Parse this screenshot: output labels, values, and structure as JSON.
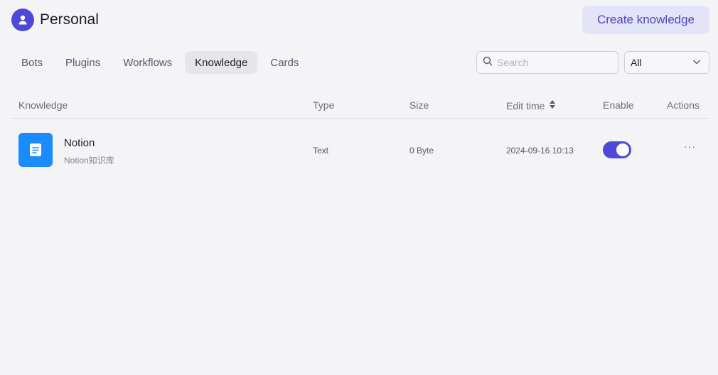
{
  "header": {
    "title": "Personal",
    "avatar_icon": "user-icon",
    "create_button": "Create knowledge"
  },
  "tabs": [
    {
      "label": "Bots",
      "active": false
    },
    {
      "label": "Plugins",
      "active": false
    },
    {
      "label": "Workflows",
      "active": false
    },
    {
      "label": "Knowledge",
      "active": true
    },
    {
      "label": "Cards",
      "active": false
    }
  ],
  "search": {
    "placeholder": "Search",
    "value": ""
  },
  "filter": {
    "selected": "All"
  },
  "table": {
    "columns": [
      "Knowledge",
      "Type",
      "Size",
      "Edit time",
      "Enable",
      "Actions"
    ],
    "rows": [
      {
        "name": "Notion",
        "description": "Notion知识库",
        "type": "Text",
        "size": "0 Byte",
        "edit_time": "2024-09-16 10:13",
        "enabled": true
      }
    ]
  },
  "colors": {
    "accent": "#4e48d8",
    "knowledge_icon_bg": "#1a8cff",
    "button_bg": "#e4e4f8"
  }
}
